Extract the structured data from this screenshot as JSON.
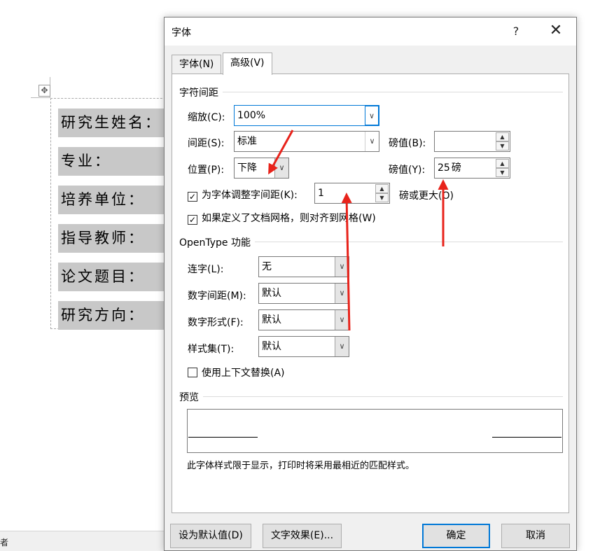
{
  "document": {
    "rows": [
      "研究生姓名：",
      "专业：",
      "培养单位：",
      "指导教师：",
      "论文题目：",
      "研究方向："
    ],
    "move_handle_icon": "move-icon",
    "status_text": "者"
  },
  "dialog": {
    "title": "字体",
    "help_label": "?",
    "close_label": "✕",
    "tabs": [
      {
        "label": "字体(N)",
        "active": false
      },
      {
        "label": "高级(V)",
        "active": true
      }
    ],
    "char_spacing": {
      "section_title": "字符间距",
      "scale": {
        "label": "缩放(C):",
        "value": "100%"
      },
      "spacing": {
        "label": "间距(S):",
        "value": "标准"
      },
      "spacing_pt": {
        "label": "磅值(B):",
        "value": ""
      },
      "position": {
        "label": "位置(P):",
        "value": "下降"
      },
      "position_pt": {
        "label": "磅值(Y):",
        "value": "25",
        "unit": "磅"
      },
      "kerning": {
        "checked": true,
        "label": "为字体调整字间距(K):",
        "value": "1",
        "suffix": "磅或更大(O)"
      },
      "snap_grid": {
        "checked": true,
        "label": "如果定义了文档网格，则对齐到网格(W)"
      }
    },
    "opentype": {
      "section_title": "OpenType 功能",
      "ligatures": {
        "label": "连字(L):",
        "value": "无"
      },
      "number_spacing": {
        "label": "数字间距(M):",
        "value": "默认"
      },
      "number_forms": {
        "label": "数字形式(F):",
        "value": "默认"
      },
      "stylistic_sets": {
        "label": "样式集(T):",
        "value": "默认"
      },
      "contextual_alternates": {
        "checked": false,
        "label": "使用上下文替换(A)"
      }
    },
    "preview": {
      "section_title": "预览",
      "note": "此字体样式限于显示，打印时将采用最相近的匹配样式。"
    },
    "buttons": {
      "set_default": "设为默认值(D)",
      "text_effects": "文字效果(E)...",
      "ok": "确定",
      "cancel": "取消"
    },
    "icons": {
      "dropdown": "chevron-down-icon",
      "spin_up": "spin-up-icon",
      "spin_down": "spin-down-icon",
      "check": "check-icon"
    }
  },
  "colors": {
    "accent": "#0078d7",
    "annotation": "#e8231b",
    "dialog_bg": "#f0f0f0",
    "highlight_row": "#c8c8c8"
  }
}
